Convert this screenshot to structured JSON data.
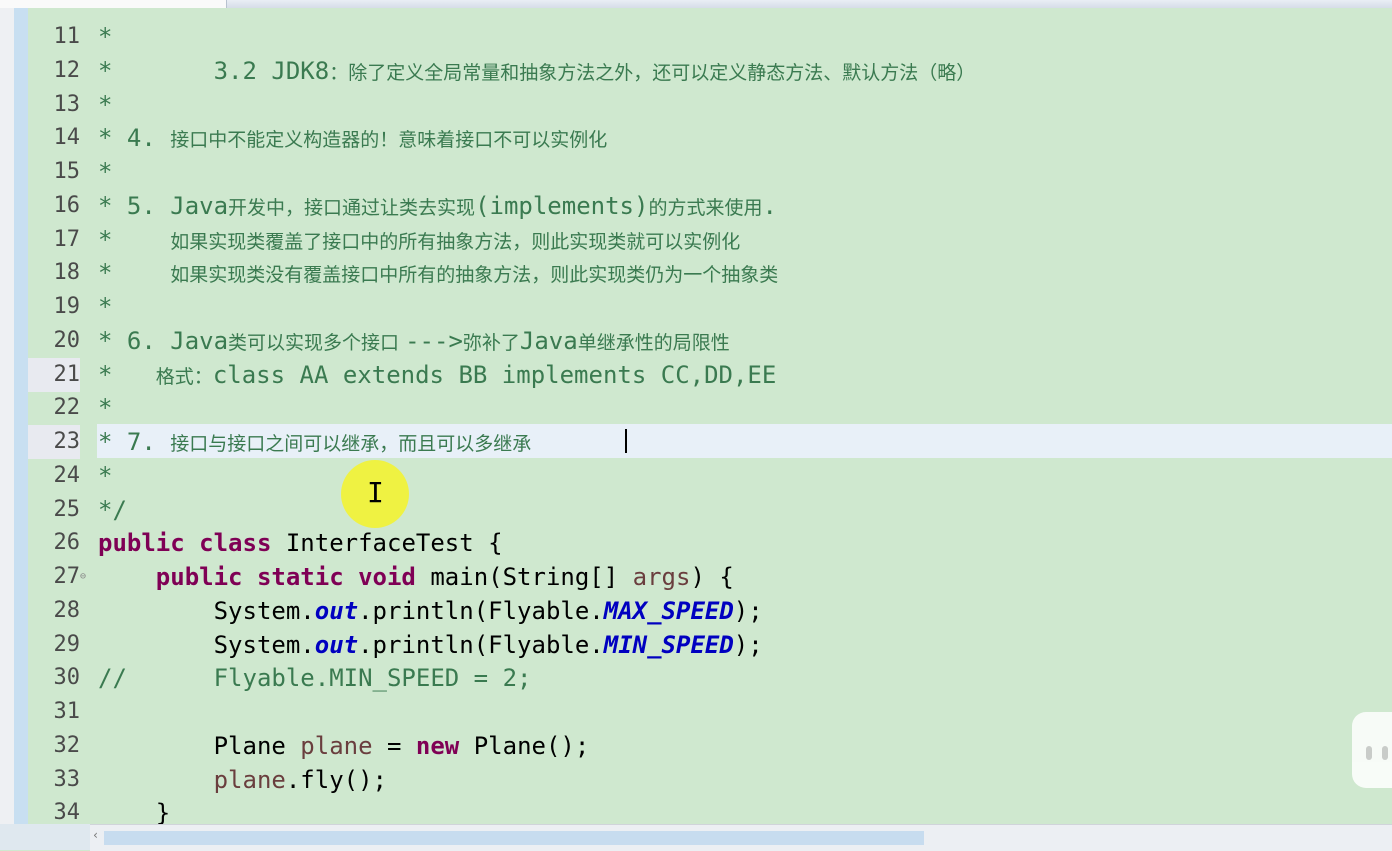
{
  "editor": {
    "lines": [
      {
        "num": "11",
        "segments": [
          {
            "t": "*",
            "c": "cmt"
          }
        ]
      },
      {
        "num": "12",
        "segments": [
          {
            "t": "*       3.2 JDK8",
            "c": "cmt"
          },
          {
            "t": "：除了定义全局常量和抽象方法之外，还可以定义静态方法、默认方法（略）",
            "c": "cmt cjk"
          }
        ]
      },
      {
        "num": "13",
        "segments": [
          {
            "t": "*",
            "c": "cmt"
          }
        ]
      },
      {
        "num": "14",
        "segments": [
          {
            "t": "* 4. ",
            "c": "cmt"
          },
          {
            "t": "接口中不能定义构造器的！意味着接口不可以实例化",
            "c": "cmt cjk"
          }
        ]
      },
      {
        "num": "15",
        "segments": [
          {
            "t": "*",
            "c": "cmt"
          }
        ]
      },
      {
        "num": "16",
        "segments": [
          {
            "t": "* 5. Java",
            "c": "cmt"
          },
          {
            "t": "开发中，接口通过让类去实现",
            "c": "cmt cjk"
          },
          {
            "t": "(implements)",
            "c": "cmt"
          },
          {
            "t": "的方式来使用",
            "c": "cmt cjk"
          },
          {
            "t": ".",
            "c": "cmt"
          }
        ]
      },
      {
        "num": "17",
        "segments": [
          {
            "t": "*    ",
            "c": "cmt"
          },
          {
            "t": "如果实现类覆盖了接口中的所有抽象方法，则此实现类就可以实例化",
            "c": "cmt cjk"
          }
        ]
      },
      {
        "num": "18",
        "segments": [
          {
            "t": "*    ",
            "c": "cmt"
          },
          {
            "t": "如果实现类没有覆盖接口中所有的抽象方法，则此实现类仍为一个抽象类",
            "c": "cmt cjk"
          }
        ]
      },
      {
        "num": "19",
        "segments": [
          {
            "t": "*",
            "c": "cmt"
          }
        ]
      },
      {
        "num": "20",
        "segments": [
          {
            "t": "* 6. Java",
            "c": "cmt"
          },
          {
            "t": "类可以实现多个接口 ",
            "c": "cmt cjk"
          },
          {
            "t": "--->",
            "c": "cmt"
          },
          {
            "t": "弥补了",
            "c": "cmt cjk"
          },
          {
            "t": "Java",
            "c": "cmt"
          },
          {
            "t": "单继承性的局限性",
            "c": "cmt cjk"
          }
        ]
      },
      {
        "num": "21",
        "segments": [
          {
            "t": "*   ",
            "c": "cmt"
          },
          {
            "t": "格式：",
            "c": "cmt cjk"
          },
          {
            "t": "class AA extends BB implements CC,DD,EE",
            "c": "cmt"
          }
        ]
      },
      {
        "num": "22",
        "segments": [
          {
            "t": "*",
            "c": "cmt"
          }
        ]
      },
      {
        "num": "23",
        "segments": [
          {
            "t": "* 7. ",
            "c": "cmt"
          },
          {
            "t": "接口与接口之间可以继承，而且可以多继承",
            "c": "cmt cjk"
          }
        ]
      },
      {
        "num": "24",
        "segments": [
          {
            "t": "*",
            "c": "cmt"
          }
        ]
      },
      {
        "num": "25",
        "segments": [
          {
            "t": "*/",
            "c": "cmt"
          }
        ]
      },
      {
        "num": "26",
        "segments": [
          {
            "t": "public class ",
            "c": "kw"
          },
          {
            "t": "InterfaceTest {",
            "c": "plain"
          }
        ]
      },
      {
        "num": "27",
        "segments": [
          {
            "t": "    public static void ",
            "c": "kw"
          },
          {
            "t": "main(String[] ",
            "c": "plain"
          },
          {
            "t": "args",
            "c": "var"
          },
          {
            "t": ") {",
            "c": "plain"
          }
        ]
      },
      {
        "num": "28",
        "segments": [
          {
            "t": "        System.",
            "c": "plain"
          },
          {
            "t": "out",
            "c": "fld"
          },
          {
            "t": ".println(Flyable.",
            "c": "plain"
          },
          {
            "t": "MAX_SPEED",
            "c": "fld"
          },
          {
            "t": ");",
            "c": "plain"
          }
        ]
      },
      {
        "num": "29",
        "segments": [
          {
            "t": "        System.",
            "c": "plain"
          },
          {
            "t": "out",
            "c": "fld"
          },
          {
            "t": ".println(Flyable.",
            "c": "plain"
          },
          {
            "t": "MIN_SPEED",
            "c": "fld"
          },
          {
            "t": ");",
            "c": "plain"
          }
        ]
      },
      {
        "num": "30",
        "segments": [
          {
            "t": "//      Flyable.MIN_SPEED = 2;",
            "c": "cmt"
          }
        ]
      },
      {
        "num": "31",
        "segments": []
      },
      {
        "num": "32",
        "segments": [
          {
            "t": "        Plane ",
            "c": "plain"
          },
          {
            "t": "plane",
            "c": "var"
          },
          {
            "t": " = ",
            "c": "plain"
          },
          {
            "t": "new",
            "c": "kw"
          },
          {
            "t": " Plane();",
            "c": "plain"
          }
        ]
      },
      {
        "num": "33",
        "segments": [
          {
            "t": "        ",
            "c": "plain"
          },
          {
            "t": "plane",
            "c": "var"
          },
          {
            "t": ".fly();",
            "c": "plain"
          }
        ]
      },
      {
        "num": "34",
        "segments": [
          {
            "t": "    }",
            "c": "plain"
          }
        ]
      }
    ],
    "current_line": "23",
    "fold_marker_line": "27",
    "colors": {
      "background": "#cfe8cf",
      "comment": "#3a7a50",
      "keyword": "#7f0055",
      "static_field": "#0000c0",
      "local_var": "#6a3e3e",
      "cursor_highlight": "#f0f23a"
    }
  },
  "icons": {
    "cursor": "ibeam-cursor-icon",
    "fold": "collapse-icon",
    "scroll_left": "scroll-left-arrow-icon",
    "watermark": "tv-watermark-icon"
  }
}
